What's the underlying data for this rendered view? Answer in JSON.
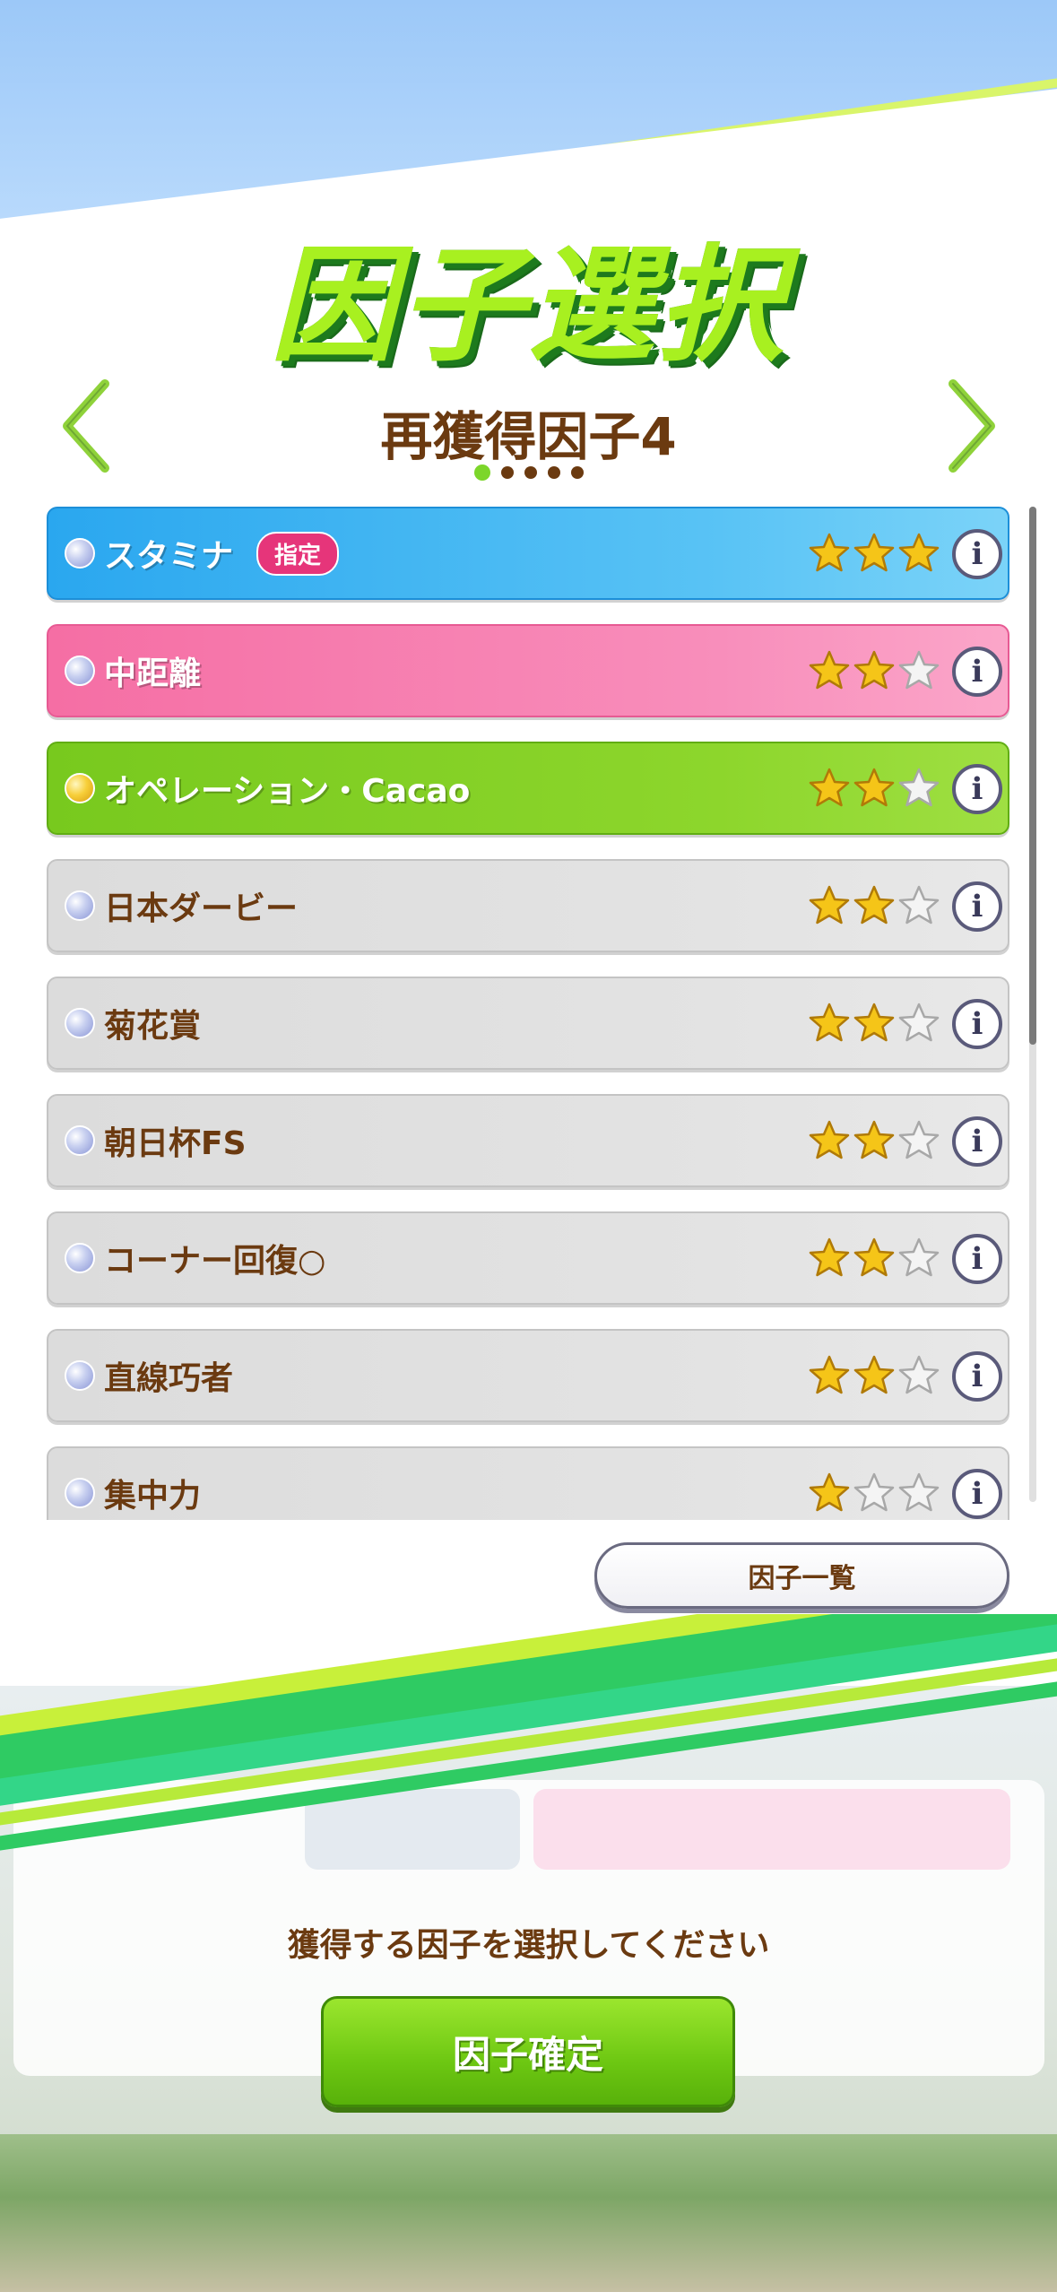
{
  "header": {
    "title": "因子選択",
    "subtitle": "再獲得因子4",
    "page_dots": 5,
    "active_dot": 0
  },
  "factors": [
    {
      "name": "スタミナ",
      "badge": "指定",
      "stars": 3,
      "color": "blue",
      "gem": "silver"
    },
    {
      "name": "中距離",
      "badge": "",
      "stars": 2,
      "color": "pink",
      "gem": "silver"
    },
    {
      "name": "オペレーション・Cacao",
      "badge": "",
      "stars": 2,
      "color": "green",
      "gem": "gold"
    },
    {
      "name": "日本ダービー",
      "badge": "",
      "stars": 2,
      "color": "grey",
      "gem": "silver"
    },
    {
      "name": "菊花賞",
      "badge": "",
      "stars": 2,
      "color": "grey",
      "gem": "silver"
    },
    {
      "name": "朝日杯FS",
      "badge": "",
      "stars": 2,
      "color": "grey",
      "gem": "silver"
    },
    {
      "name": "コーナー回復○",
      "badge": "",
      "stars": 2,
      "color": "grey",
      "gem": "silver"
    },
    {
      "name": "直線巧者",
      "badge": "",
      "stars": 2,
      "color": "grey",
      "gem": "silver"
    },
    {
      "name": "集中力",
      "badge": "",
      "stars": 1,
      "color": "grey",
      "gem": "silver"
    }
  ],
  "factor_list_button": "因子一覧",
  "prompt": "獲得する因子を選択してください",
  "confirm_button": "因子確定",
  "colors": {
    "brown_text": "#6b3a10",
    "accent_green": "#7cd62a",
    "badge_pink": "#e6357a",
    "star_gold": "#f5c518"
  }
}
